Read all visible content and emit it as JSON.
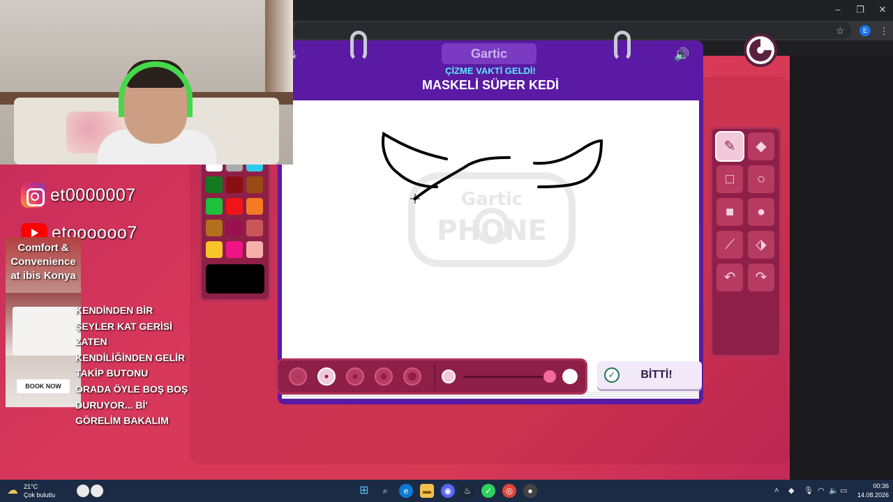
{
  "browser": {
    "window_controls": [
      "–",
      "❐",
      "✕"
    ],
    "profile_initial": "E"
  },
  "overlay": {
    "instagram": "et0000007",
    "youtube": "etoooooo7",
    "ad": {
      "headline": "Comfort & Convenience at ibis Konya",
      "button": "BOOK NOW"
    },
    "chat_lines": [
      "KENDİNDEN BİR",
      "ŞEYLER KAT GERİSİ",
      "ZATEN",
      "KENDİLİĞİNDEN GELİR",
      "TAKİP BUTONU",
      "ORADA ÖYLE BOŞ BOŞ",
      "DURUYOR... Bİ'",
      "GÖRELİM BAKALIM"
    ]
  },
  "game": {
    "logo": "Gartic",
    "subtitle": "ÇİZME VAKTİ GELDİ!",
    "prompt": "MASKELİ SÜPER KEDİ",
    "watermark_top": "Gartic",
    "watermark_bottom": "PHONE",
    "done_label": "BİTTİ!",
    "timer_remaining_fraction": 0.25,
    "selected_color": "#000000",
    "selected_brush_index": 1,
    "selected_tool": "pencil",
    "palette": [
      "#000000",
      "#666666",
      "#1a4fc8",
      "#ffffff",
      "#aaaaaa",
      "#2ecbf0",
      "#137a22",
      "#8b0f12",
      "#9a4a14",
      "#1ec23a",
      "#f0141a",
      "#f57a24",
      "#b0701e",
      "#99124f",
      "#c9575a",
      "#f7c52a",
      "#ef1486",
      "#f5b0a8"
    ],
    "tools": [
      {
        "name": "pencil",
        "glyph": "✎"
      },
      {
        "name": "eraser",
        "glyph": "◆"
      },
      {
        "name": "rectangle-outline",
        "glyph": "□"
      },
      {
        "name": "ellipse-outline",
        "glyph": "○"
      },
      {
        "name": "rectangle-filled",
        "glyph": "■"
      },
      {
        "name": "ellipse-filled",
        "glyph": "●"
      },
      {
        "name": "line",
        "glyph": "⟋"
      },
      {
        "name": "fill-bucket",
        "glyph": "⬗"
      },
      {
        "name": "undo",
        "glyph": "↶"
      },
      {
        "name": "redo",
        "glyph": "↷"
      }
    ]
  },
  "taskbar": {
    "weather_temp": "21°C",
    "weather_desc": "Çok bulutlu",
    "clock_time": "00:36",
    "clock_date": "14.08.2026"
  }
}
